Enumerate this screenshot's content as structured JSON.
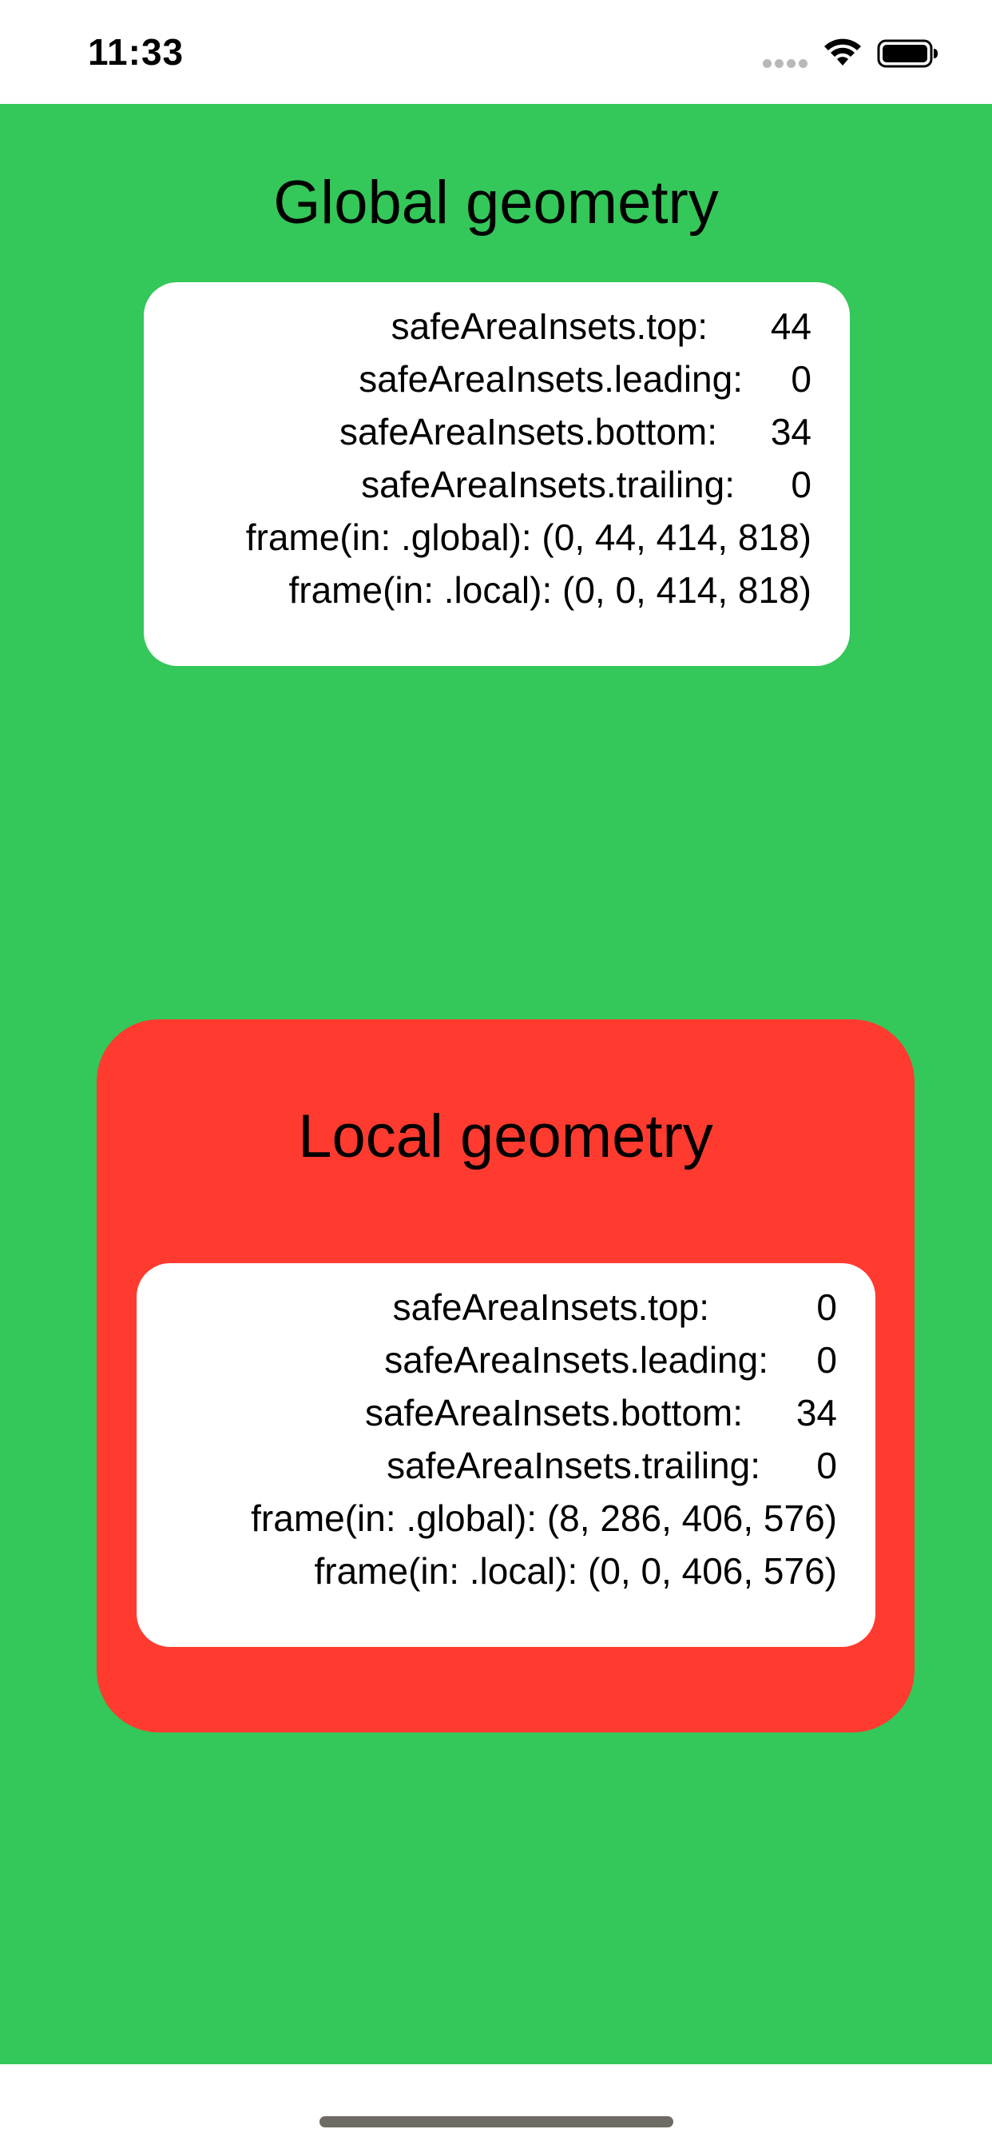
{
  "status_bar": {
    "time": "11:33"
  },
  "global": {
    "title": "Global geometry",
    "rows": [
      {
        "label": "safeAreaInsets.top:",
        "value": "44"
      },
      {
        "label": "safeAreaInsets.leading:",
        "value": "0"
      },
      {
        "label": "safeAreaInsets.bottom:",
        "value": "34"
      },
      {
        "label": "safeAreaInsets.trailing:",
        "value": "0"
      }
    ],
    "frame_global": "frame(in: .global): (0, 44, 414, 818)",
    "frame_local": "frame(in: .local): (0, 0, 414, 818)"
  },
  "local": {
    "title": "Local geometry",
    "rows": [
      {
        "label": "safeAreaInsets.top:",
        "value": "0"
      },
      {
        "label": "safeAreaInsets.leading:",
        "value": "0"
      },
      {
        "label": "safeAreaInsets.bottom:",
        "value": "34"
      },
      {
        "label": "safeAreaInsets.trailing:",
        "value": "0"
      }
    ],
    "frame_global": "frame(in: .global): (8, 286, 406, 576)",
    "frame_local": "frame(in: .local): (0, 0, 406, 576)"
  },
  "colors": {
    "background_green": "#34c759",
    "local_panel_red": "#ff3b30",
    "card_white": "#ffffff"
  }
}
